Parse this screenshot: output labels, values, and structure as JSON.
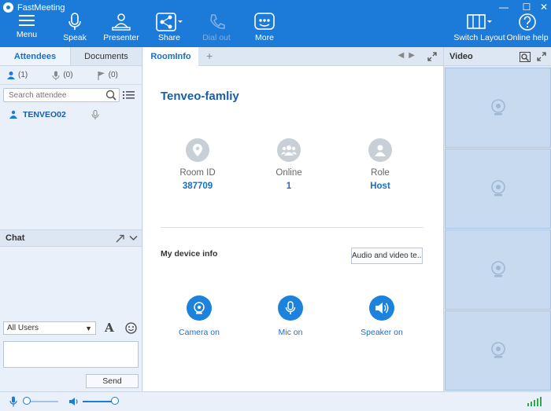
{
  "app": {
    "title": "FastMeeting"
  },
  "toolbar": {
    "menu": "Menu",
    "speak": "Speak",
    "presenter": "Presenter",
    "share": "Share",
    "dial_out": "Dial out",
    "more": "More",
    "switch_layout": "Switch Layout",
    "online_help": "Online help"
  },
  "left": {
    "tabs": [
      "Attendees",
      "Documents"
    ],
    "counts": {
      "attendees": "(1)",
      "speakers": "(0)",
      "hands": "(0)"
    },
    "search_placeholder": "Search attendee",
    "attendee": "TENVEO02",
    "chat_title": "Chat",
    "chat_target": "All Users",
    "send": "Send"
  },
  "center": {
    "tab": "RoomInfo",
    "room_name": "Tenveo-famliy",
    "stats": [
      {
        "label": "Room ID",
        "value": "387709"
      },
      {
        "label": "Online",
        "value": "1"
      },
      {
        "label": "Role",
        "value": "Host"
      }
    ],
    "device_title": "My device info",
    "av_test": "Audio and video te...",
    "devices": [
      "Camera on",
      "Mic on",
      "Speaker on"
    ]
  },
  "right": {
    "title": "Video"
  },
  "colors": {
    "brand": "#1c7bd8",
    "accent": "#1a6fc4"
  }
}
